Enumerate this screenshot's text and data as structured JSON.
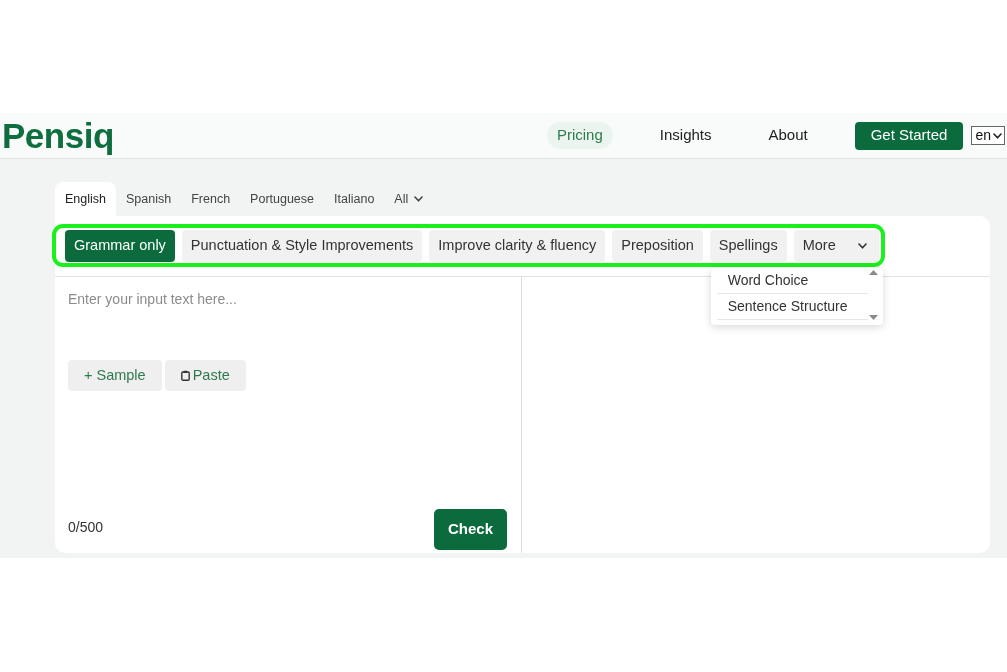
{
  "header": {
    "logo": "Pensiq",
    "nav": [
      {
        "label": "Pricing",
        "selected": true
      },
      {
        "label": "Insights",
        "selected": false
      },
      {
        "label": "About",
        "selected": false
      }
    ],
    "cta": "Get Started",
    "language_select": {
      "value": "en"
    }
  },
  "language_tabs": [
    {
      "label": "English",
      "selected": true,
      "kind": "tab"
    },
    {
      "label": "Spanish",
      "selected": false,
      "kind": "tab"
    },
    {
      "label": "French",
      "selected": false,
      "kind": "tab"
    },
    {
      "label": "Portuguese",
      "selected": false,
      "kind": "tab"
    },
    {
      "label": "Italiano",
      "selected": false,
      "kind": "tab"
    },
    {
      "label": "All",
      "selected": false,
      "kind": "dropdown"
    }
  ],
  "modes": {
    "highlighted": true,
    "items": [
      {
        "label": "Grammar only",
        "selected": true,
        "kind": "button"
      },
      {
        "label": "Punctuation & Style Improvements",
        "selected": false,
        "kind": "button"
      },
      {
        "label": "Improve clarity & fluency",
        "selected": false,
        "kind": "button"
      },
      {
        "label": "Preposition",
        "selected": false,
        "kind": "button"
      },
      {
        "label": "Spellings",
        "selected": false,
        "kind": "button"
      },
      {
        "label": "More",
        "selected": false,
        "kind": "dropdown"
      }
    ]
  },
  "more_menu": {
    "open": true,
    "items": [
      "Word Choice",
      "Sentence Structure"
    ]
  },
  "editor": {
    "placeholder": "Enter your input text here...",
    "buttons": [
      {
        "label": "+ Sample",
        "kind": "plain"
      },
      {
        "label": "Paste",
        "kind": "clipboard"
      }
    ],
    "counter": "0/500",
    "check_button": "Check"
  }
}
